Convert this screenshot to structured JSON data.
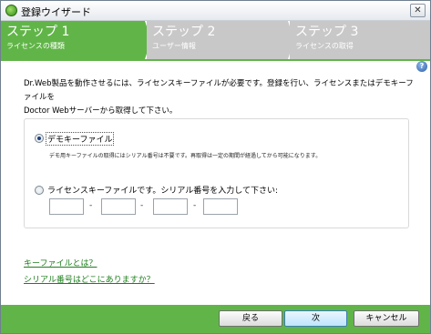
{
  "window": {
    "title": "登録ウイザード",
    "close_glyph": "✕"
  },
  "steps": [
    {
      "title": "ステップ 1",
      "subtitle": "ライセンスの種類",
      "active": true
    },
    {
      "title": "ステップ 2",
      "subtitle": "ユーザー情報",
      "active": false
    },
    {
      "title": "ステップ 3",
      "subtitle": "ライセンスの取得",
      "active": false
    }
  ],
  "help_glyph": "?",
  "intro": {
    "line1": "Dr.Web製品を動作させるには、ライセンスキーファイルが必要です。登録を行い、ライセンスまたはデモキーファイルを",
    "line2": "Doctor Webサーバーから取得して下さい。"
  },
  "options": {
    "demo_label": "デモキーファイル",
    "demo_note": "デモ用キーファイルの取得にはシリアル番号は不要です。再取得は一定の期間が経過してから可能になります。",
    "demo_selected": true,
    "key_label": "ライセンスキーファイルです。シリアル番号を入力して下さい:",
    "key_selected": false,
    "serial_separator": "-",
    "serial_values": [
      "",
      "",
      "",
      ""
    ]
  },
  "links": {
    "what_is_key": "キーファイルとは？",
    "where_serial": "シリアル番号はどこにありますか？"
  },
  "buttons": {
    "back": "戻る",
    "next": "次",
    "cancel": "キャンセル"
  },
  "colors": {
    "accent_green": "#61b548",
    "inactive_step": "#c8c8c8",
    "link_green": "#1e7f1e"
  }
}
